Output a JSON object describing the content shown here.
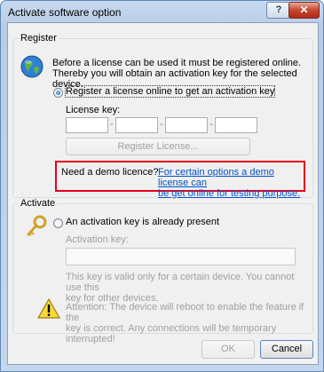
{
  "window": {
    "title": "Activate software option",
    "help_glyph": "?",
    "close_glyph": "✕"
  },
  "register": {
    "legend": "Register",
    "description_line1": "Before a license can be used it must be registered online.",
    "description_line2": "Thereby you will obtain an activation key for the selected device.",
    "radio_label": "Register a license online to get an activation key",
    "radio_selected": true,
    "license_key_label": "License key:",
    "key_fields": [
      "",
      "",
      "",
      ""
    ],
    "key_separator": "-",
    "register_button": "Register License...",
    "demo_label": "Need a demo licence?",
    "demo_link_line1": "For certain options a demo license can",
    "demo_link_line2": "be get online for testing purpose.",
    "highlight_color": "#e3001b"
  },
  "activate": {
    "legend": "Activate",
    "radio_label": "An activation key is already present",
    "radio_selected": false,
    "activation_key_label": "Activation key:",
    "activation_key_value": "",
    "note_line1": "This key is valid only for a certain device. You cannot use this",
    "note_line2": "key for other devices.",
    "warning_line1": "Attention: The device will reboot to enable the feature if the",
    "warning_line2": "key is correct. Any connections will be temporary interrupted!"
  },
  "footer": {
    "ok_button": "OK",
    "cancel_button": "Cancel"
  },
  "icons": {
    "register": "globe-icon",
    "activate": "key-icon",
    "warning": "warning-icon"
  }
}
